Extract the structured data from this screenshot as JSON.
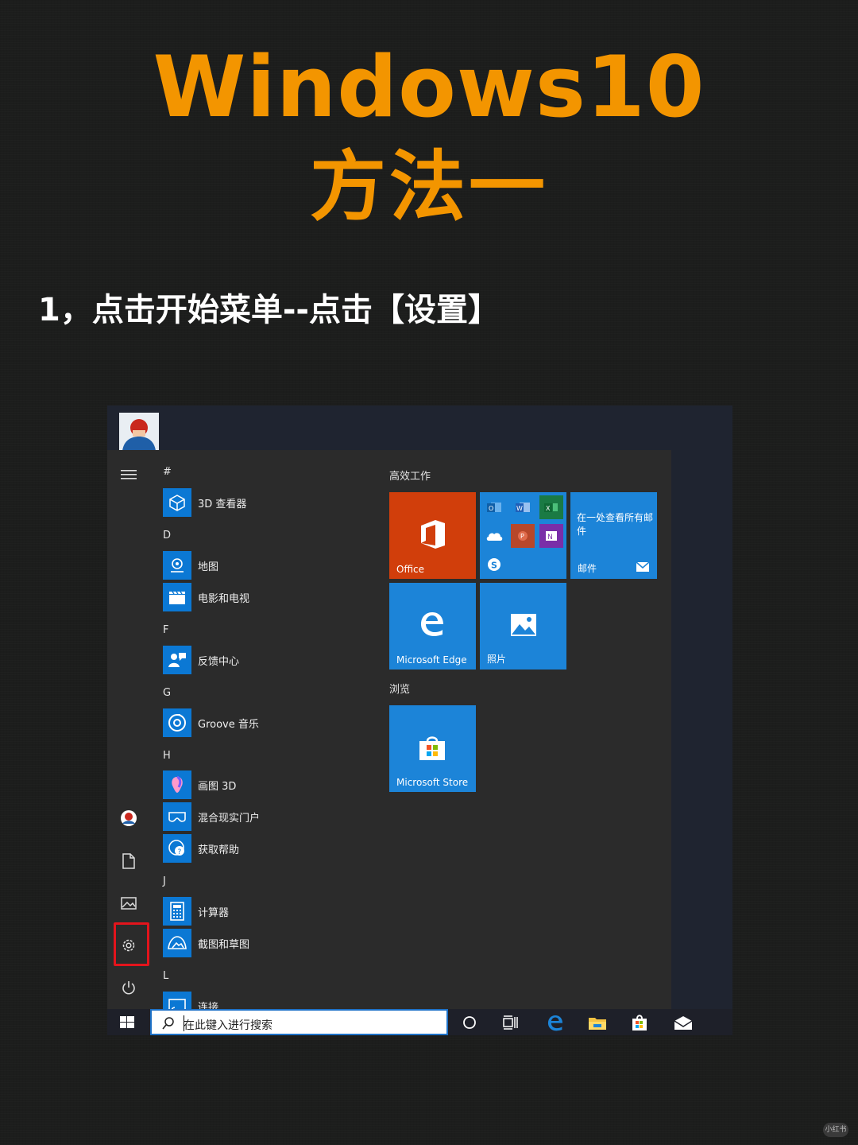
{
  "header": {
    "title_en": "Windows10",
    "title_cn": "方法一",
    "step": "1，点击开始菜单--点击【设置】"
  },
  "colors": {
    "accent": "#f39500",
    "office_tile": "#d13e0b",
    "tile_blue": "#1c84d8",
    "highlight": "#e3141c"
  },
  "start_menu": {
    "apps": [
      {
        "letter": "#"
      },
      {
        "label": "3D 查看器",
        "icon": "cube-icon"
      },
      {
        "letter": "D"
      },
      {
        "label": "地图",
        "icon": "map-pin-icon"
      },
      {
        "label": "电影和电视",
        "icon": "clapper-icon"
      },
      {
        "letter": "F"
      },
      {
        "label": "反馈中心",
        "icon": "feedback-icon"
      },
      {
        "letter": "G"
      },
      {
        "label": "Groove 音乐",
        "icon": "music-icon"
      },
      {
        "letter": "H"
      },
      {
        "label": "画图 3D",
        "icon": "paint-icon"
      },
      {
        "label": "混合现实门户",
        "icon": "vr-icon"
      },
      {
        "label": "获取帮助",
        "icon": "help-icon"
      },
      {
        "letter": "J"
      },
      {
        "label": "计算器",
        "icon": "calculator-icon"
      },
      {
        "label": "截图和草图",
        "icon": "snip-icon"
      },
      {
        "letter": "L"
      },
      {
        "label": "连接",
        "icon": "connect-icon"
      }
    ],
    "groups": {
      "productivity": "高效工作",
      "browse": "浏览"
    },
    "tiles": {
      "office": "Office",
      "mail_text": "在一处查看所有邮件",
      "mail": "邮件",
      "edge": "Microsoft Edge",
      "photos": "照片",
      "store": "Microsoft Store"
    }
  },
  "taskbar": {
    "search_placeholder": "在此键入进行搜索"
  },
  "watermark": "小红书"
}
